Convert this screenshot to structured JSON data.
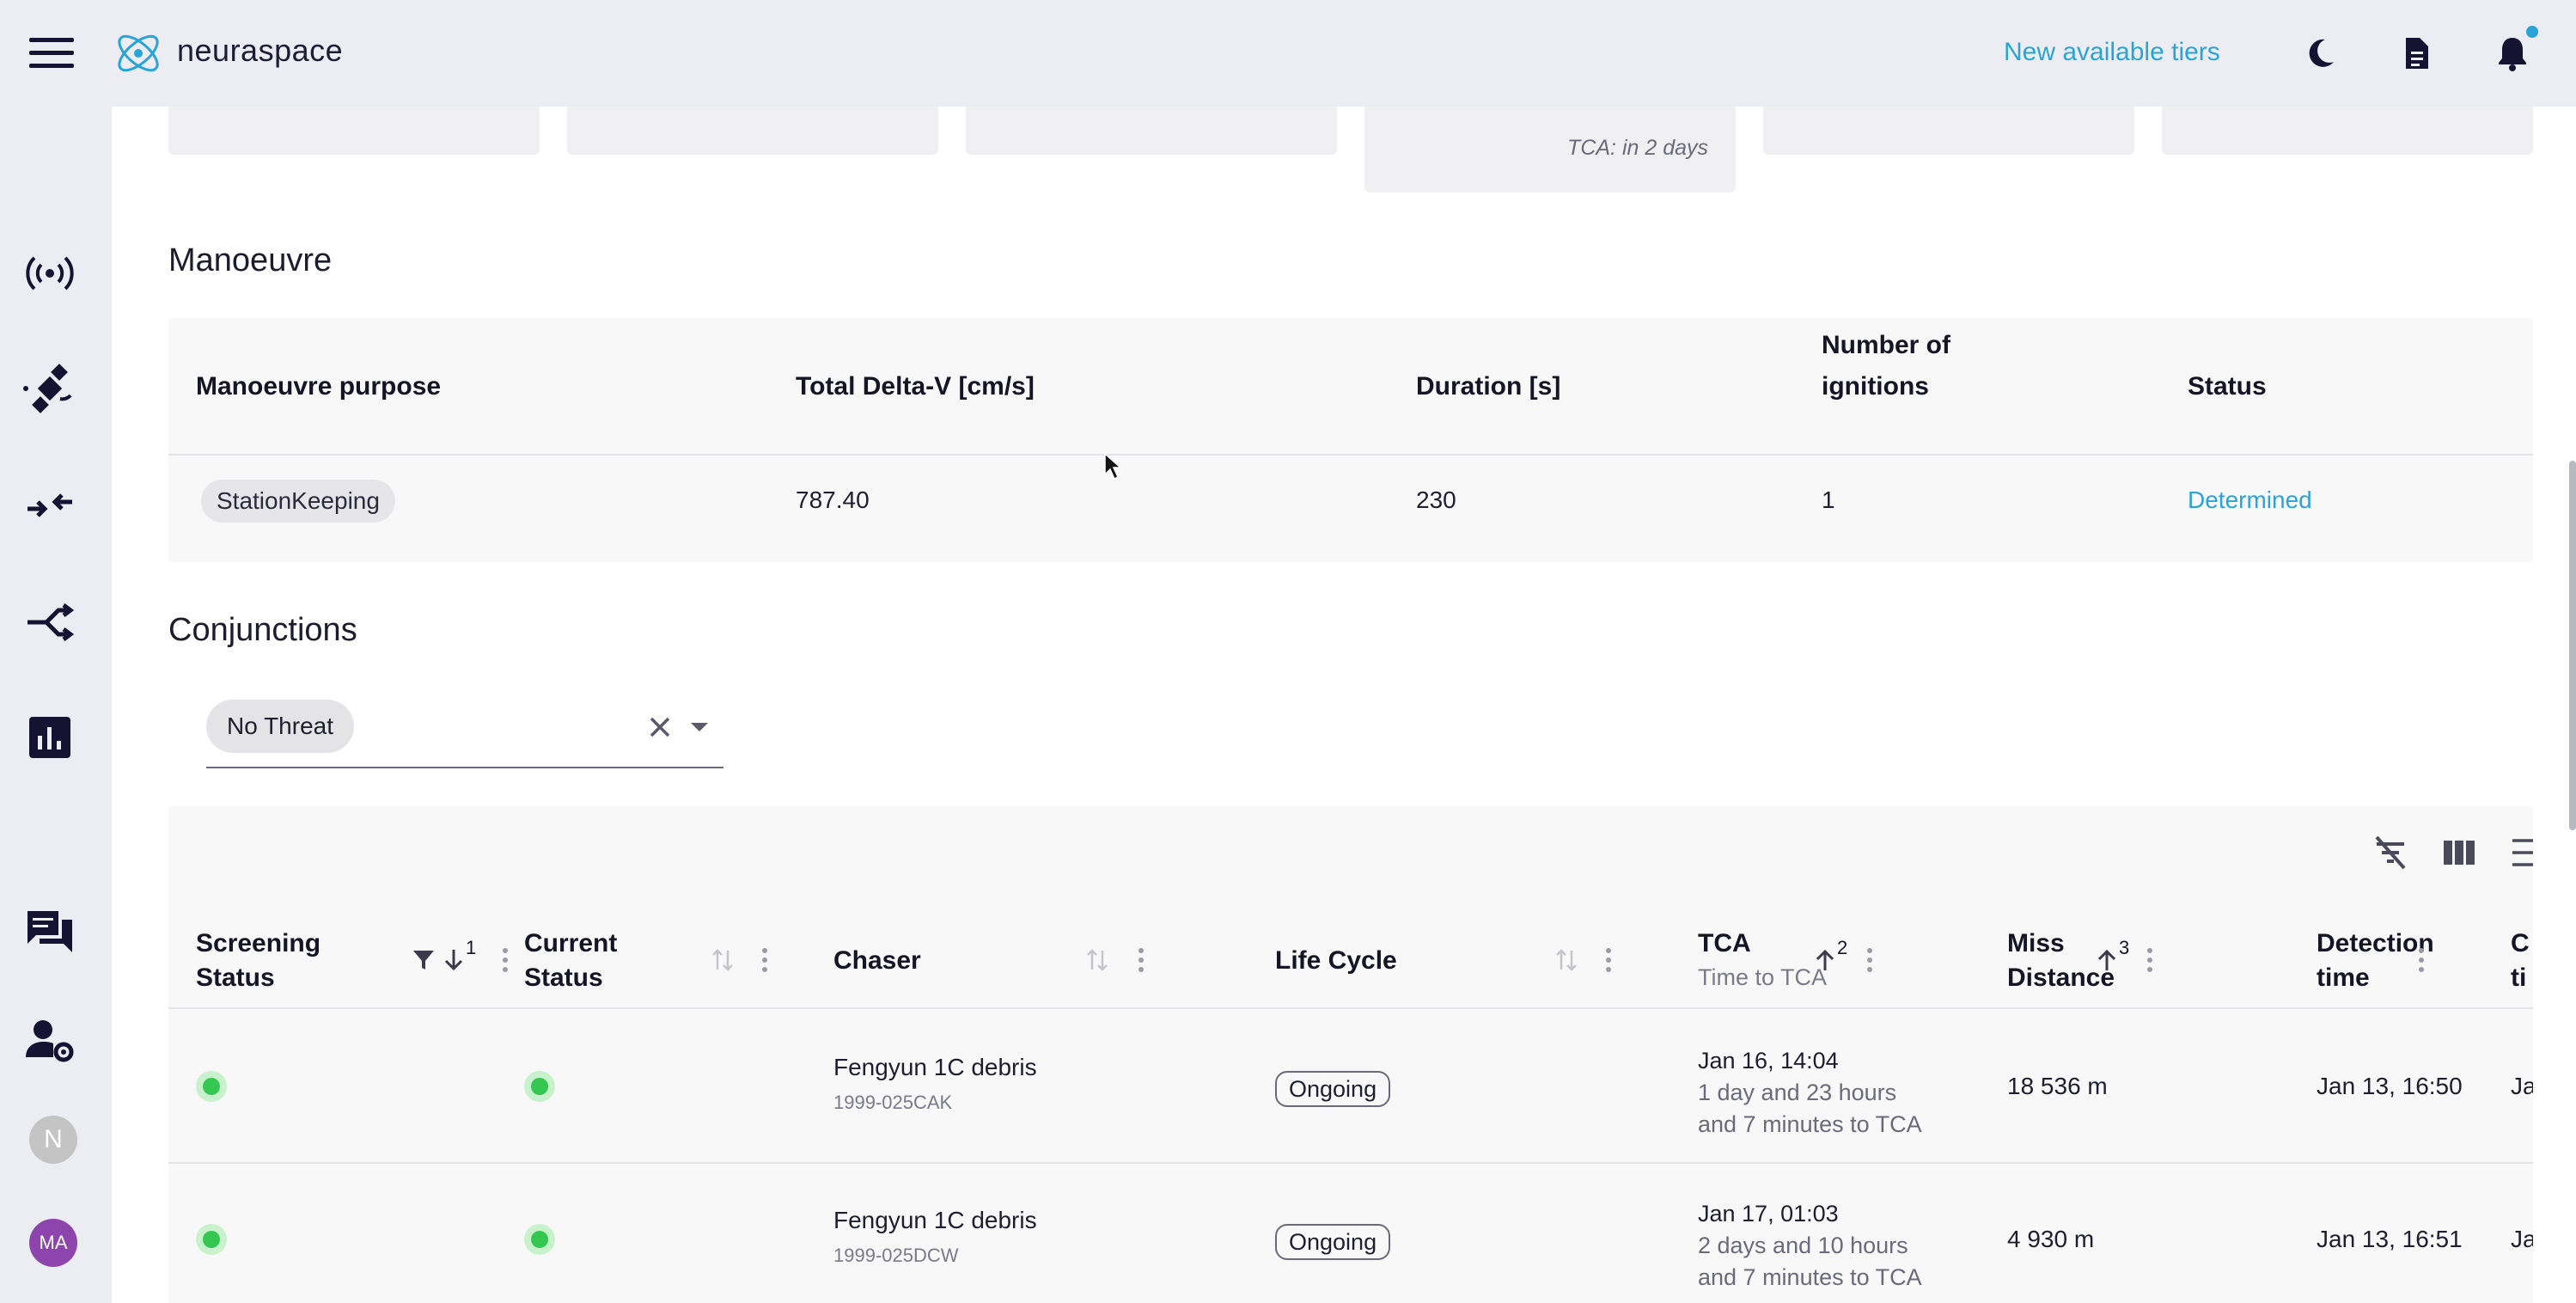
{
  "header": {
    "brand": "neuraspace",
    "tiers_link": "New available tiers",
    "icons": [
      "menu-icon",
      "moon-icon",
      "document-icon",
      "bell-icon"
    ],
    "accent_color": "#2aa4d8"
  },
  "sidebar": {
    "icons": [
      "broadcast-icon",
      "satellite-icon",
      "merge-arrows-icon",
      "branch-arrows-icon",
      "bar-chart-icon",
      "chat-icon",
      "user-settings-icon"
    ],
    "avatars": [
      {
        "label": "N",
        "color": "#c4c4c4"
      },
      {
        "label": "MA",
        "color": "#8e44ad"
      }
    ]
  },
  "top_cards": {
    "tca_text": "TCA: in 2 days"
  },
  "manoeuvre": {
    "title": "Manoeuvre",
    "headers": {
      "purpose": "Manoeuvre purpose",
      "delta_v": "Total Delta-V [cm/s]",
      "duration": "Duration [s]",
      "ignitions_line1": "Number of",
      "ignitions_line2": "ignitions",
      "status": "Status"
    },
    "row": {
      "purpose": "StationKeeping",
      "delta_v": "787.40",
      "duration": "230",
      "ignitions": "1",
      "status": "Determined"
    }
  },
  "conjunctions": {
    "title": "Conjunctions",
    "filter_chip": "No Threat",
    "toolbar_icons": [
      "clear-filters-icon",
      "columns-icon",
      "density-icon",
      "fullscreen-icon"
    ],
    "headers": {
      "screening_l1": "Screening",
      "screening_l2": "Status",
      "screening_sort": "1",
      "current_l1": "Current",
      "current_l2": "Status",
      "chaser": "Chaser",
      "lifecycle": "Life Cycle",
      "tca": "TCA",
      "tca_sub": "Time to TCA",
      "tca_sort": "2",
      "miss_l1": "Miss",
      "miss_l2": "Distance",
      "miss_sort": "3",
      "detection_l1": "Detection",
      "detection_l2": "time",
      "next_l1": "C",
      "next_l2": "ti"
    },
    "rows": [
      {
        "chaser": "Fengyun 1C debris",
        "chaser_id": "1999-025CAK",
        "lifecycle": "Ongoing",
        "tca": "Jan 16, 14:04",
        "tca_rel1": "1 day and 23 hours",
        "tca_rel2": "and 7 minutes to TCA",
        "miss": "18 536 m",
        "detection": "Jan 13, 16:50",
        "next": "Ja"
      },
      {
        "chaser": "Fengyun 1C debris",
        "chaser_id": "1999-025DCW",
        "lifecycle": "Ongoing",
        "tca": "Jan 17, 01:03",
        "tca_rel1": "2 days and 10 hours",
        "tca_rel2": "and 7 minutes to TCA",
        "miss": "4 930 m",
        "detection": "Jan 13, 16:51",
        "next": "Ja"
      }
    ]
  }
}
